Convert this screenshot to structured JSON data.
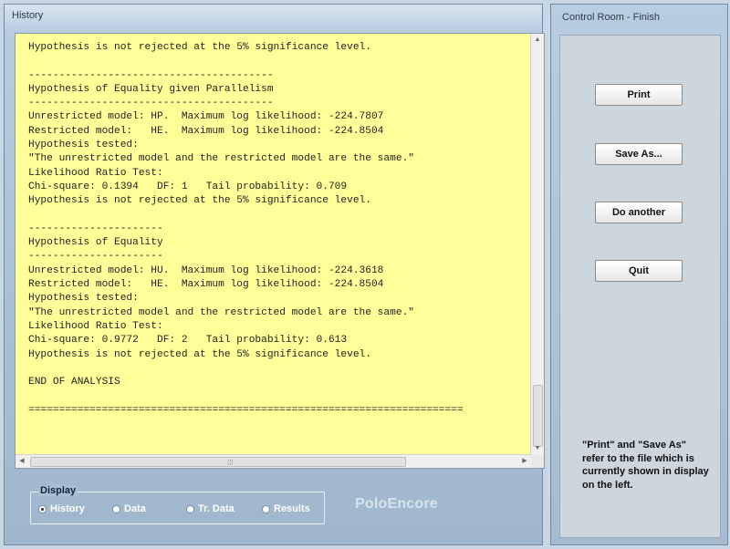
{
  "history_window": {
    "title": "History",
    "lines": [
      "Hypothesis is not rejected at the 5% significance level.",
      "",
      "----------------------------------------",
      "Hypothesis of Equality given Parallelism",
      "----------------------------------------",
      "Unrestricted model: HP.  Maximum log likelihood: -224.7807",
      "Restricted model:   HE.  Maximum log likelihood: -224.8504",
      "Hypothesis tested:",
      "\"The unrestricted model and the restricted model are the same.\"",
      "Likelihood Ratio Test:",
      "Chi-square: 0.1394   DF: 1   Tail probability: 0.709",
      "Hypothesis is not rejected at the 5% significance level.",
      "",
      "----------------------",
      "Hypothesis of Equality",
      "----------------------",
      "Unrestricted model: HU.  Maximum log likelihood: -224.3618",
      "Restricted model:   HE.  Maximum log likelihood: -224.8504",
      "Hypothesis tested:",
      "\"The unrestricted model and the restricted model are the same.\"",
      "Likelihood Ratio Test:",
      "Chi-square: 0.9772   DF: 2   Tail probability: 0.613",
      "Hypothesis is not rejected at the 5% significance level.",
      "",
      "END OF ANALYSIS",
      "",
      "======================================================================="
    ],
    "display": {
      "label": "Display",
      "options": [
        {
          "label": "History",
          "selected": true
        },
        {
          "label": "Data",
          "selected": false
        },
        {
          "label": "Tr. Data",
          "selected": false
        },
        {
          "label": "Results",
          "selected": false
        }
      ]
    },
    "brand": "PoloEncore"
  },
  "control_window": {
    "title": "Control Room - Finish",
    "buttons": {
      "print": "Print",
      "save_as": "Save As...",
      "do_another": "Do another",
      "quit": "Quit"
    },
    "note": "\"Print\" and \"Save As\" refer to the file which is currently shown in display on the left."
  },
  "colors": {
    "text_background": "#ffff99",
    "window_frame": "#b9cde0",
    "brand_text": "#d7e3ee"
  }
}
